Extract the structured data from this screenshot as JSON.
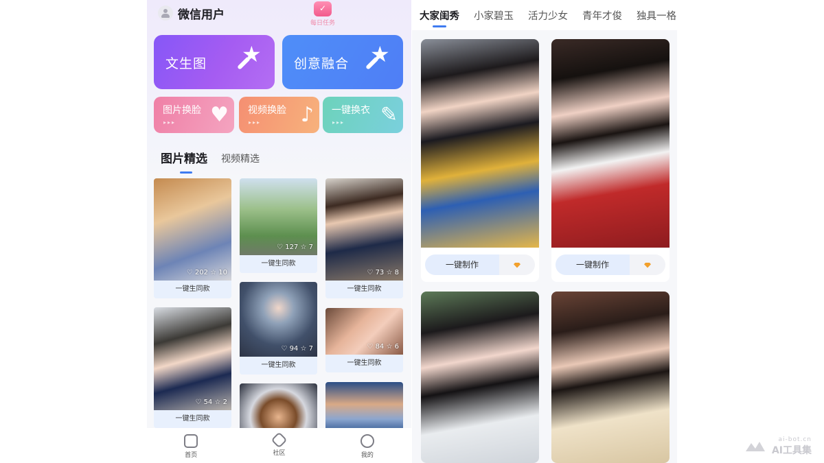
{
  "left": {
    "user": {
      "name": "微信用户"
    },
    "daily_task": {
      "label": "每日任务"
    },
    "big_cards": [
      {
        "label": "文生图"
      },
      {
        "label": "创意融合"
      }
    ],
    "small_cards": [
      {
        "label": "图片换脸",
        "arrows": "▸▸▸"
      },
      {
        "label": "视频换脸",
        "arrows": "▸▸▸"
      },
      {
        "label": "一键换衣",
        "arrows": "▸▸▸"
      }
    ],
    "tabs": [
      {
        "label": "图片精选",
        "active": true
      },
      {
        "label": "视频精选",
        "active": false
      }
    ],
    "feed": [
      {
        "likes": "202",
        "favs": "10",
        "action": "一键生同款"
      },
      {
        "likes": "127",
        "favs": "7",
        "action": "一键生同款"
      },
      {
        "likes": "73",
        "favs": "8",
        "action": "一键生同款"
      },
      {
        "likes": "94",
        "favs": "7",
        "action": "一键生同款"
      },
      {
        "likes": "84",
        "favs": "6",
        "action": "一键生同款"
      },
      {
        "likes": "54",
        "favs": "2",
        "action": "一键生同款"
      },
      {
        "likes": "",
        "favs": "",
        "action": ""
      },
      {
        "likes": "",
        "favs": "",
        "action": ""
      }
    ],
    "bottom_nav": [
      {
        "label": "首页",
        "icon": "home-icon"
      },
      {
        "label": "社区",
        "icon": "community-icon"
      },
      {
        "label": "我的",
        "icon": "profile-icon"
      }
    ]
  },
  "right": {
    "tabs": [
      {
        "label": "大家闺秀",
        "active": true
      },
      {
        "label": "小家碧玉",
        "active": false
      },
      {
        "label": "活力少女",
        "active": false
      },
      {
        "label": "青年才俊",
        "active": false
      },
      {
        "label": "独具一格",
        "active": false
      }
    ],
    "cards": [
      {
        "action": "一键制作"
      },
      {
        "action": "一键制作"
      },
      {
        "action": ""
      },
      {
        "action": ""
      }
    ]
  },
  "watermark": {
    "url": "ai-bot.cn",
    "text": "AI工具集"
  },
  "colors": {
    "accent": "#3e7bf0",
    "gem": "#f2a02c"
  }
}
